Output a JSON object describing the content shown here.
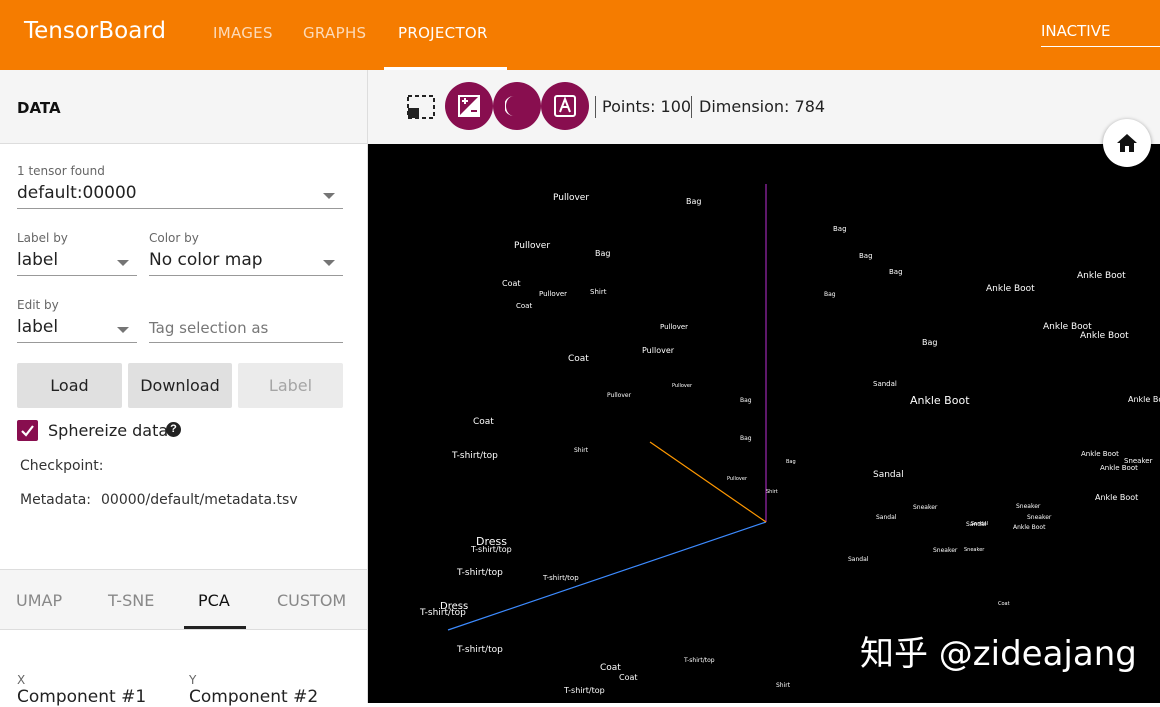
{
  "app": {
    "title": "TensorBoard"
  },
  "nav": {
    "tabs": [
      {
        "label": "IMAGES"
      },
      {
        "label": "GRAPHS"
      },
      {
        "label": "PROJECTOR"
      }
    ],
    "status_select": "INACTIVE"
  },
  "data_panel": {
    "title": "DATA",
    "tensor_found": "1 tensor found",
    "tensor": "default:00000",
    "label_by": {
      "label": "Label by",
      "value": "label"
    },
    "color_by": {
      "label": "Color by",
      "value": "No color map"
    },
    "edit_by": {
      "label": "Edit by",
      "value": "label"
    },
    "tag_selection_placeholder": "Tag selection as",
    "buttons": {
      "load": "Load",
      "download": "Download",
      "label": "Label"
    },
    "sphereize": {
      "label": "Sphereize data",
      "checked": true
    },
    "checkpoint": {
      "label": "Checkpoint:",
      "value": ""
    },
    "metadata": {
      "label": "Metadata:",
      "value": "00000/default/metadata.tsv"
    }
  },
  "projection_tabs": [
    {
      "label": "UMAP"
    },
    {
      "label": "T-SNE"
    },
    {
      "label": "PCA"
    },
    {
      "label": "CUSTOM"
    }
  ],
  "pca": {
    "x": {
      "label": "X",
      "value": "Component #1"
    },
    "y": {
      "label": "Y",
      "value": "Component #2"
    }
  },
  "toolbar": {
    "icons": [
      "select-rectangle-icon",
      "night-mode-icon",
      "label-mode-icon",
      "brightness-icon",
      "home-icon"
    ],
    "points": "Points: 100",
    "dimension": "Dimension: 784"
  },
  "colors": {
    "accent": "#f57c00",
    "primary": "#880e4f",
    "axis_x": "#3d8bff",
    "axis_y": "#9c27b0",
    "axis_z": "#ff9800"
  },
  "scatter_labels": [
    {
      "text": "Pullover"
    },
    {
      "text": "Bag"
    },
    {
      "text": "Bag"
    },
    {
      "text": "Pullover"
    },
    {
      "text": "Bag"
    },
    {
      "text": "Bag"
    },
    {
      "text": "Bag"
    },
    {
      "text": "Ankle Boot"
    },
    {
      "text": "Coat"
    },
    {
      "text": "Pullover"
    },
    {
      "text": "Shirt"
    },
    {
      "text": "Ankle Boot"
    },
    {
      "text": "Coat"
    },
    {
      "text": "Bag"
    },
    {
      "text": "Pullover"
    },
    {
      "text": "Ankle Boot"
    },
    {
      "text": "Ankle Boot"
    },
    {
      "text": "Pullover"
    },
    {
      "text": "Bag"
    },
    {
      "text": "Coat"
    },
    {
      "text": "Sandal"
    },
    {
      "text": "Pullover"
    },
    {
      "text": "Pullover"
    },
    {
      "text": "Ankle Boot"
    },
    {
      "text": "Ankle Boot"
    },
    {
      "text": "Bag"
    },
    {
      "text": "Coat"
    },
    {
      "text": "Bag"
    },
    {
      "text": "Shirt"
    },
    {
      "text": "T-shirt/top"
    },
    {
      "text": "Ankle Boot"
    },
    {
      "text": "Sneaker"
    },
    {
      "text": "Ankle Boot"
    },
    {
      "text": "Bag"
    },
    {
      "text": "Sandal"
    },
    {
      "text": "Pullover"
    },
    {
      "text": "Shirt"
    },
    {
      "text": "Ankle Boot"
    },
    {
      "text": "Sneaker"
    },
    {
      "text": "Sandal"
    },
    {
      "text": "Sneaker"
    },
    {
      "text": "Sneaker"
    },
    {
      "text": "Sandal"
    },
    {
      "text": "Ankle Boot"
    },
    {
      "text": "Dress"
    },
    {
      "text": "T-shirt/top"
    },
    {
      "text": "Sneaker"
    },
    {
      "text": "Sneaker"
    },
    {
      "text": "Sandal"
    },
    {
      "text": "Sandal"
    },
    {
      "text": "T-shirt/top"
    },
    {
      "text": "T-shirt/top"
    },
    {
      "text": "Dress"
    },
    {
      "text": "T-shirt/top"
    },
    {
      "text": "Coat"
    },
    {
      "text": "T-shirt/top"
    },
    {
      "text": "Coat"
    },
    {
      "text": "Coat"
    },
    {
      "text": "T-shirt/top"
    },
    {
      "text": "T-shirt/top"
    },
    {
      "text": "Shirt"
    }
  ],
  "watermark": "知乎 @zideajang"
}
